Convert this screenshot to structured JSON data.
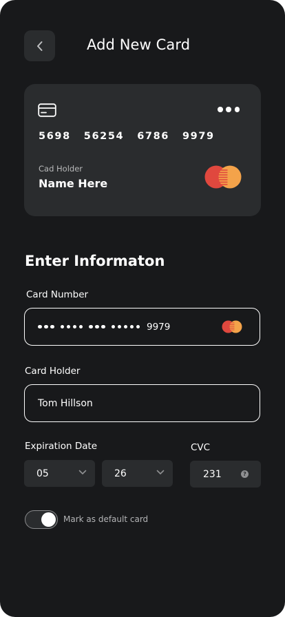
{
  "header": {
    "title": "Add New Card",
    "back_icon": "chevron-left-icon"
  },
  "card_preview": {
    "number_groups": [
      "5698",
      "56254",
      "6786",
      "9979"
    ],
    "holder_label": "Cad Holder",
    "holder_name": "Name Here",
    "card_icon": "credit-card-icon",
    "menu_icon": "more-dots-icon",
    "brand_icon": "mastercard-logo"
  },
  "form": {
    "section_title": "Enter Informaton",
    "card_number": {
      "label": "Card Number",
      "masked_groups": [
        3,
        4,
        3,
        5
      ],
      "last4": "9979"
    },
    "card_holder": {
      "label": "Card Holder",
      "value": "Tom Hillson"
    },
    "expiration": {
      "label": "Expiration Date",
      "month": "05",
      "year": "26"
    },
    "cvc": {
      "label": "CVC",
      "value": "231",
      "help_glyph": "?"
    },
    "default_toggle": {
      "label": "Mark as default card",
      "on": true
    }
  },
  "colors": {
    "background": "#18191b",
    "surface": "#2a2c2e",
    "mastercard_red": "#e0483e",
    "mastercard_orange": "#f4a34a"
  }
}
